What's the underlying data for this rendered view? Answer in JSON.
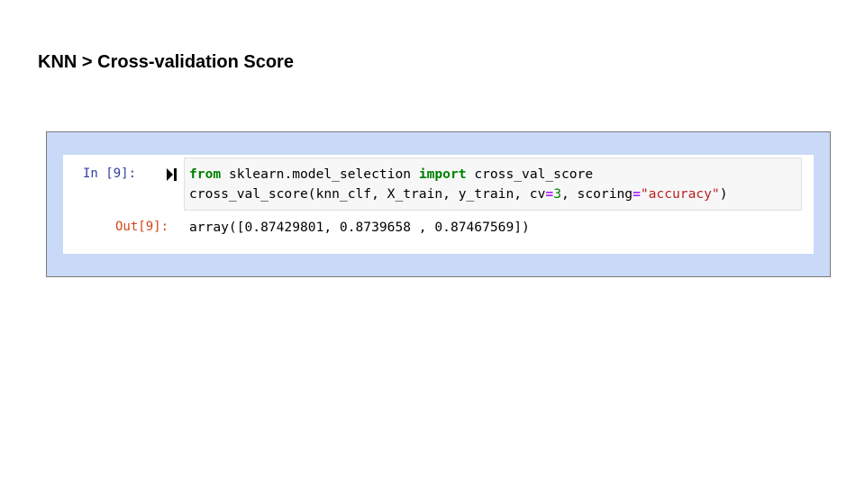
{
  "slide": {
    "title": "KNN > Cross-validation Score"
  },
  "cell": {
    "in_prompt": "In [9]:",
    "out_prompt": "Out[9]:",
    "run_icon": "run-cell-icon",
    "code": {
      "line1": {
        "kw_from": "from",
        "module": " sklearn.model_selection ",
        "kw_import": "import",
        "name": " cross_val_score"
      },
      "line2": {
        "call": "cross_val_score(knn_clf, X_train, y_train, cv",
        "eq1": "=",
        "cv_value": "3",
        "mid": ", scoring",
        "eq2": "=",
        "scoring_value": "\"accuracy\"",
        "close": ")"
      }
    },
    "output": "array([0.87429801, 0.8739658 , 0.87467569])"
  },
  "colors": {
    "frame_background": "#c9daf8",
    "in_prompt": "#303f9f",
    "out_prompt": "#d84315",
    "keyword": "#008000",
    "string": "#ba2121",
    "operator": "#aa22ff"
  }
}
